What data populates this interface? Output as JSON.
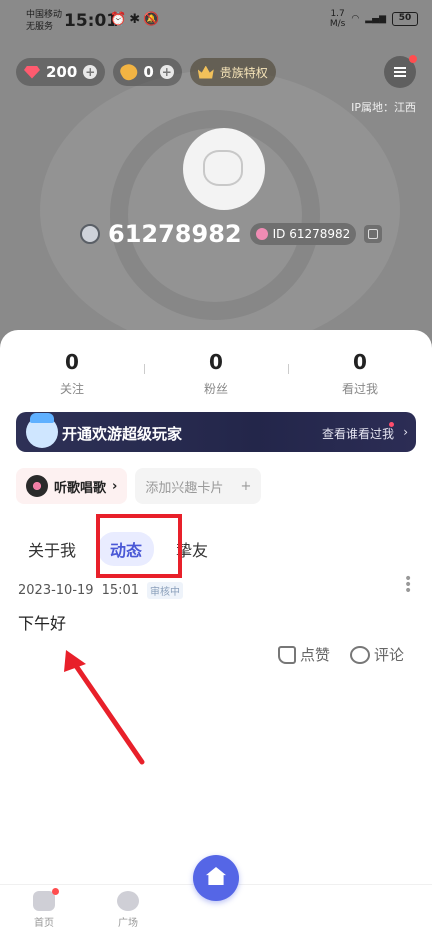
{
  "status_bar": {
    "carrier_line1": "中国移动",
    "carrier_line2": "无服务",
    "time": "15:01",
    "net_speed": "1.7",
    "net_unit": "M/s",
    "battery": "50"
  },
  "top": {
    "gems": "200",
    "coins": "0",
    "noble_label": "贵族特权",
    "ip_location": "IP属地：江西"
  },
  "profile": {
    "username": "61278982",
    "id_label": "ID 61278982"
  },
  "stats": [
    {
      "value": "0",
      "label": "关注"
    },
    {
      "value": "0",
      "label": "粉丝"
    },
    {
      "value": "0",
      "label": "看过我"
    }
  ],
  "vip": {
    "title": "开通欢游超级玩家",
    "link": "查看谁看过我",
    "arrow": "›"
  },
  "chips": {
    "song_label": "听歌唱歌",
    "song_arrow": "›",
    "add_label": "添加兴趣卡片",
    "add_plus": "+"
  },
  "tabs": [
    {
      "label": "关于我"
    },
    {
      "label": "动态",
      "active": true
    },
    {
      "label": "挚友"
    }
  ],
  "post": {
    "date": "2023-10-19",
    "time": "15:01",
    "review_badge": "审核中",
    "content": "下午好",
    "like_label": "点赞",
    "comment_label": "评论"
  },
  "bottom_nav": [
    {
      "label": "首页",
      "icon": "gamepad-icon"
    },
    {
      "label": "广场",
      "icon": "planet-icon"
    },
    {
      "label": "",
      "icon": "home-icon"
    }
  ],
  "colors": {
    "accent": "#5566e6",
    "highlight_box": "#e8202a",
    "vip_bg": "#2e3156"
  }
}
